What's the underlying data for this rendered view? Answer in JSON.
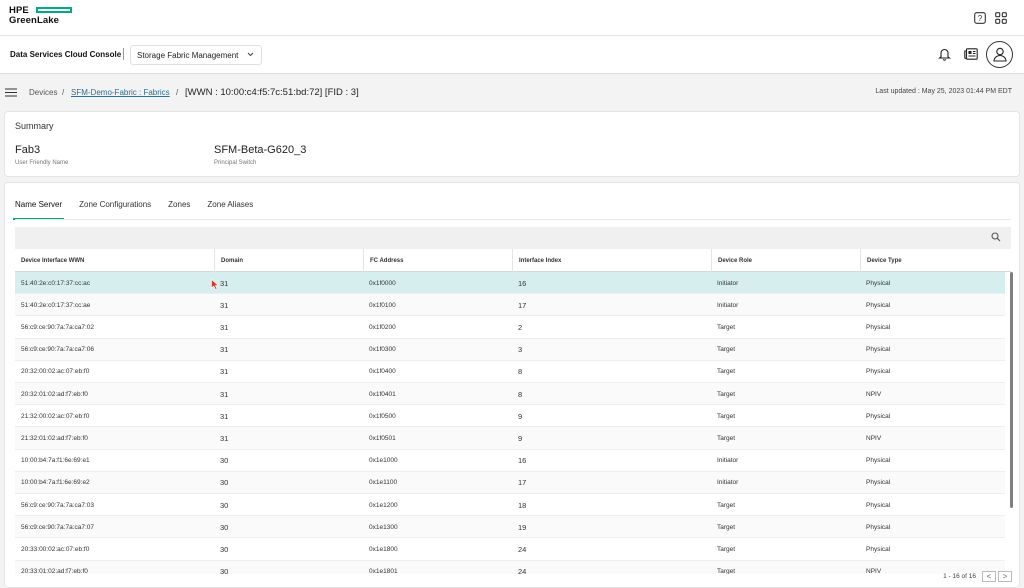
{
  "brand": {
    "line1": "HPE",
    "line2": "GreenLake"
  },
  "topbar": {
    "help_icon": "help-icon",
    "apps_icon": "apps-grid-icon"
  },
  "appbar": {
    "title": "Data Services Cloud Console",
    "service": "Storage Fabric Management",
    "icons": [
      "bell-icon",
      "news-icon",
      "user-icon"
    ]
  },
  "breadcrumb": {
    "devices": "Devices",
    "fabric": "SFM-Demo-Fabric : Fabrics",
    "current": "[WWN : 10:00:c4:f5:7c:51:bd:72] [FID : 3]",
    "sep": "/"
  },
  "last_updated": "Last updated : May 25, 2023 01:44 PM EDT",
  "summary": {
    "title": "Summary",
    "name_value": "Fab3",
    "name_label": "User Friendly Name",
    "switch_value": "SFM-Beta-G620_3",
    "switch_label": "Principal Switch"
  },
  "tabs": [
    "Name Server",
    "Zone Configurations",
    "Zones",
    "Zone Aliases"
  ],
  "table": {
    "columns": [
      "Device Interface WWN",
      "Domain",
      "FC Address",
      "Interface Index",
      "Device Role",
      "Device Type"
    ],
    "rows": [
      [
        "51:40:2e:c0:17:37:cc:ac",
        "31",
        "0x1f0000",
        "16",
        "Initiator",
        "Physical"
      ],
      [
        "51:40:2e:c0:17:37:cc:ae",
        "31",
        "0x1f0100",
        "17",
        "Initiator",
        "Physical"
      ],
      [
        "56:c9:ce:90:7a:7a:ca7:02",
        "31",
        "0x1f0200",
        "2",
        "Target",
        "Physical"
      ],
      [
        "56:c9:ce:90:7a:7a:ca7:06",
        "31",
        "0x1f0300",
        "3",
        "Target",
        "Physical"
      ],
      [
        "20:32:00:02:ac:07:eb:f0",
        "31",
        "0x1f0400",
        "8",
        "Target",
        "Physical"
      ],
      [
        "20:32:01:02:ad:f7:eb:f0",
        "31",
        "0x1f0401",
        "8",
        "Target",
        "NPIV"
      ],
      [
        "21:32:00:02:ac:07:eb:f0",
        "31",
        "0x1f0500",
        "9",
        "Target",
        "Physical"
      ],
      [
        "21:32:01:02:ad:f7:eb:f0",
        "31",
        "0x1f0501",
        "9",
        "Target",
        "NPIV"
      ],
      [
        "10:00:b4:7a:f1:6e:69:e1",
        "30",
        "0x1e1000",
        "16",
        "Initiator",
        "Physical"
      ],
      [
        "10:00:b4:7a:f1:6e:69:e2",
        "30",
        "0x1e1100",
        "17",
        "Initiator",
        "Physical"
      ],
      [
        "56:c9:ce:90:7a:7a:ca7:03",
        "30",
        "0x1e1200",
        "18",
        "Target",
        "Physical"
      ],
      [
        "56:c9:ce:90:7a:7a:ca7:07",
        "30",
        "0x1e1300",
        "19",
        "Target",
        "Physical"
      ],
      [
        "20:33:00:02:ac:07:eb:f0",
        "30",
        "0x1e1800",
        "24",
        "Target",
        "Physical"
      ],
      [
        "20:33:01:02:ad:f7:eb:f0",
        "30",
        "0x1e1801",
        "24",
        "Target",
        "NPIV"
      ]
    ]
  },
  "pagination": {
    "text": "1 - 16 of 16",
    "prev": "<",
    "next": ">"
  },
  "colors": {
    "accent": "#01a982",
    "selected_row": "#d6efee",
    "link": "#2d6d8f"
  }
}
